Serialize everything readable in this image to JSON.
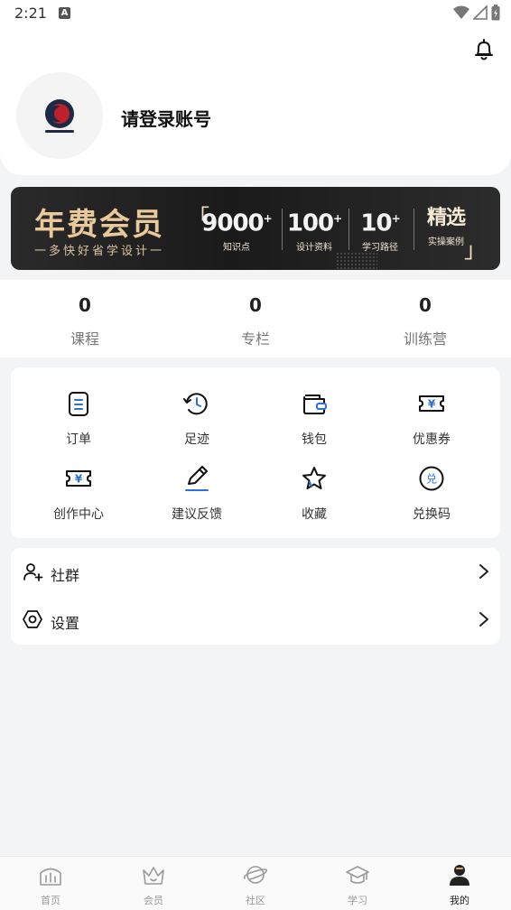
{
  "status": {
    "time": "2:21",
    "notif_letter": "A"
  },
  "profile": {
    "login_text": "请登录账号"
  },
  "banner": {
    "title": "年费会员",
    "subtitle": "一多快好省学设计一",
    "stats": [
      {
        "big": "9000",
        "small": "知识点"
      },
      {
        "big": "100",
        "small": "设计资料"
      },
      {
        "big": "10",
        "small": "学习路径"
      },
      {
        "big": "精选",
        "small": "实操案例"
      }
    ]
  },
  "counts": [
    {
      "value": "0",
      "label": "课程"
    },
    {
      "value": "0",
      "label": "专栏"
    },
    {
      "value": "0",
      "label": "训练营"
    }
  ],
  "grid": [
    {
      "label": "订单",
      "icon": "order-icon"
    },
    {
      "label": "足迹",
      "icon": "history-icon"
    },
    {
      "label": "钱包",
      "icon": "wallet-icon"
    },
    {
      "label": "优惠券",
      "icon": "coupon-icon"
    },
    {
      "label": "创作中心",
      "icon": "creator-icon"
    },
    {
      "label": "建议反馈",
      "icon": "feedback-icon"
    },
    {
      "label": "收藏",
      "icon": "star-icon"
    },
    {
      "label": "兑换码",
      "icon": "redeem-icon"
    }
  ],
  "grid_symbols": {
    "yen": "¥",
    "redeem": "兑"
  },
  "list": [
    {
      "label": "社群",
      "icon": "community-icon"
    },
    {
      "label": "设置",
      "icon": "settings-icon"
    }
  ],
  "tabs": [
    {
      "label": "首页",
      "icon": "home-icon"
    },
    {
      "label": "会员",
      "icon": "crown-icon"
    },
    {
      "label": "社区",
      "icon": "planet-icon"
    },
    {
      "label": "学习",
      "icon": "grad-cap-icon"
    },
    {
      "label": "我的",
      "icon": "user-icon",
      "active": true
    }
  ],
  "colors": {
    "accent_blue": "#2b6fe0",
    "brand_red": "#c0202e",
    "banner_gold": "#e9c99a"
  }
}
